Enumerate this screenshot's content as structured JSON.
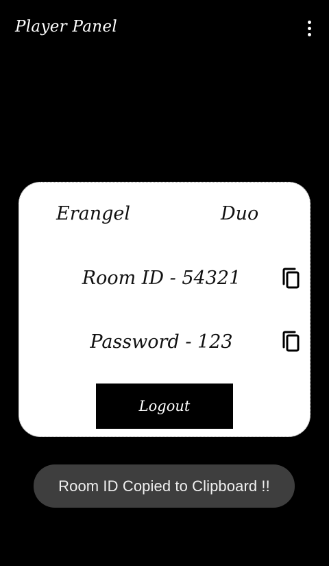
{
  "app_bar": {
    "title": "Player Panel",
    "menu_icon": "more-vert-icon"
  },
  "match_card": {
    "map": "Erangel",
    "mode": "Duo",
    "room_id_text": "Room ID - 54321",
    "password_text": "Password - 123",
    "copy_icon": "content-copy-icon",
    "logout_label": "Logout"
  },
  "toast": {
    "message": "Room ID Copied to Clipboard !!"
  },
  "colors": {
    "background": "#000000",
    "card": "#ffffff",
    "button": "#000000",
    "toast": "#3e3e3e"
  }
}
